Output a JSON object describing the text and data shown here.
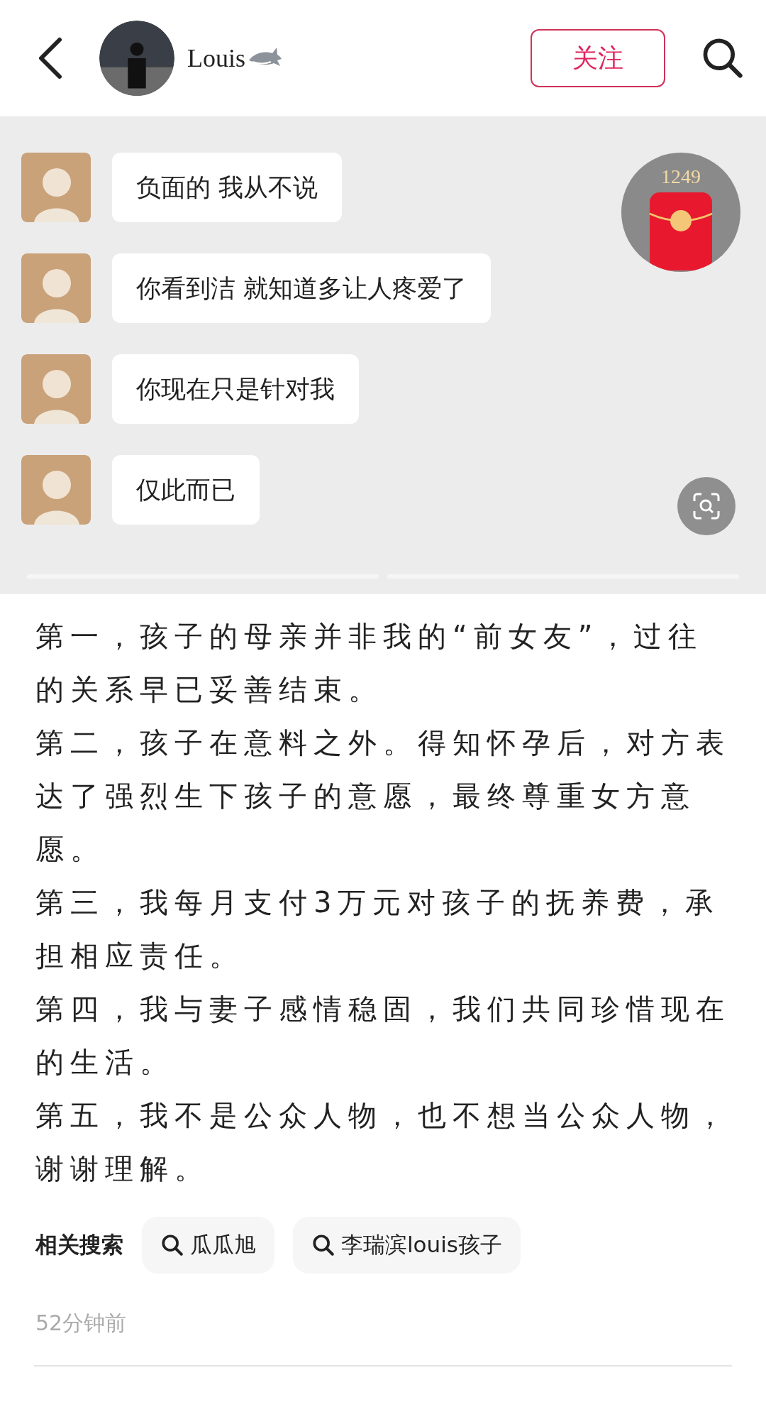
{
  "header": {
    "author_name": "Louis",
    "follow_button": "关注"
  },
  "carousel": {
    "messages": [
      {
        "text": "负面的 我从不说"
      },
      {
        "text": "你看到洁 就知道多让人疼爱了"
      },
      {
        "text": "你现在只是针对我"
      },
      {
        "text": "仅此而已"
      }
    ],
    "red_packet": {
      "count": "1249"
    }
  },
  "content": [
    "第一，孩子的母亲并非我的“前女友”，过往的关系早已妥善结束。",
    "第二，孩子在意料之外。得知怀孕后，对方表达了强烈生下孩子的意愿，最终尊重女方意愿。",
    "第三，我每月支付3万元对孩子的抚养费，承担相应责任。",
    "第四，我与妻子感情稳固，我们共同珍惜现在的生活。",
    "第五，我不是公众人物，也不想当公众人物，谢谢理解。"
  ],
  "related_searches": {
    "label": "相关搜索",
    "items": [
      "瓜瓜旭",
      "李瑞滨louis孩子"
    ]
  },
  "time": "52分钟前"
}
